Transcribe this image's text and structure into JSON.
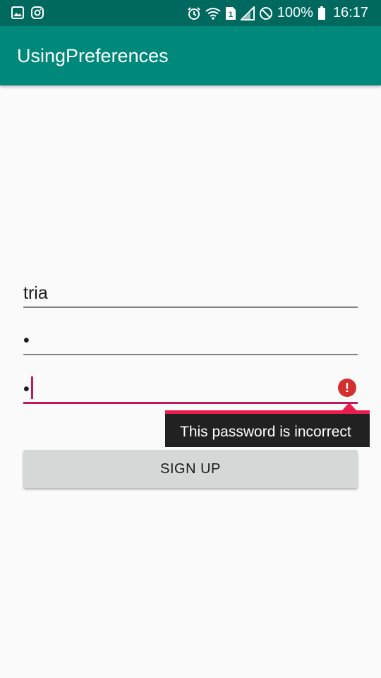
{
  "status_bar": {
    "left_icons": [
      "gallery-icon",
      "instagram-icon"
    ],
    "right_icons": [
      "alarm-icon",
      "wifi-icon",
      "sim-icon",
      "signal-icon",
      "block-icon",
      "battery-icon"
    ],
    "sim_slot": "1",
    "battery": "100%",
    "time": "16:17"
  },
  "app_bar": {
    "title": "UsingPreferences"
  },
  "form": {
    "username_value": "tria",
    "password_value": "•",
    "confirm_password_value": "•",
    "error_message": "This password is incorrect",
    "error_icon_glyph": "!",
    "signup_label": "SIGN UP"
  },
  "colors": {
    "status_bar": "#00695f",
    "app_bar": "#00897b",
    "accent": "#c2185b",
    "error": "#d32f2f",
    "background": "#fafafa",
    "button": "#d6d7d7"
  }
}
